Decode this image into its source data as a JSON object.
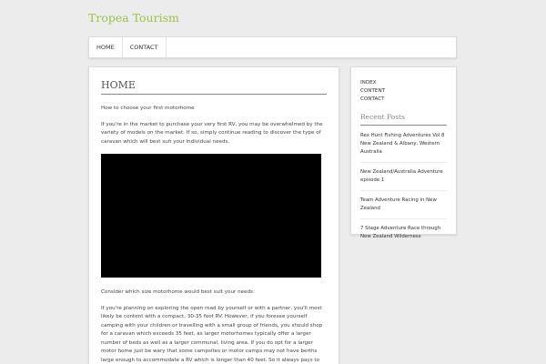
{
  "site": {
    "title": "Tropea Tourism"
  },
  "nav": {
    "items": [
      "HOME",
      "CONTACT"
    ]
  },
  "main": {
    "title": "HOME",
    "paragraphs": [
      "How to choose your first motorhome",
      "If you're in the market to purchase your very first RV, you may be overwhelmed by the variety of models on the market. If so, simply continue reading to discover the type of caravan which will best suit your individual needs."
    ],
    "after_video": [
      "Consider which size motorhome would best suit your needs:",
      "If you're planning on exploring the open road by yourself or with a partner, you'll most likely be content with a compact, 30-35 foot RV. However, if you foresee yourself camping with your children or travelling with a small group of friends, you should shop for a caravan which exceeds 35 feet, as larger motorhomes typically offer a larger number of beds as well as a larger communal, living area. If you do opt for a larger motor home just be wary that some campsites or motor camps may not have berths large enough to accommodate a RV which is longer than 40 feet. So it always pays to ring the manager of"
    ]
  },
  "sidebar": {
    "links": [
      "INDEX",
      "CONTENT",
      "CONTACT"
    ],
    "recent_title": "Recent Posts",
    "posts": [
      "Rex Hunt Fishing Adventures Vol 8 New Zealand & Albany, Western Australia",
      "New Zealand/Australia Adventure episode 1",
      "Team Adventure Racing in New Zealand",
      "7 Stage Adventure Race through New Zealand Wilderness"
    ]
  }
}
